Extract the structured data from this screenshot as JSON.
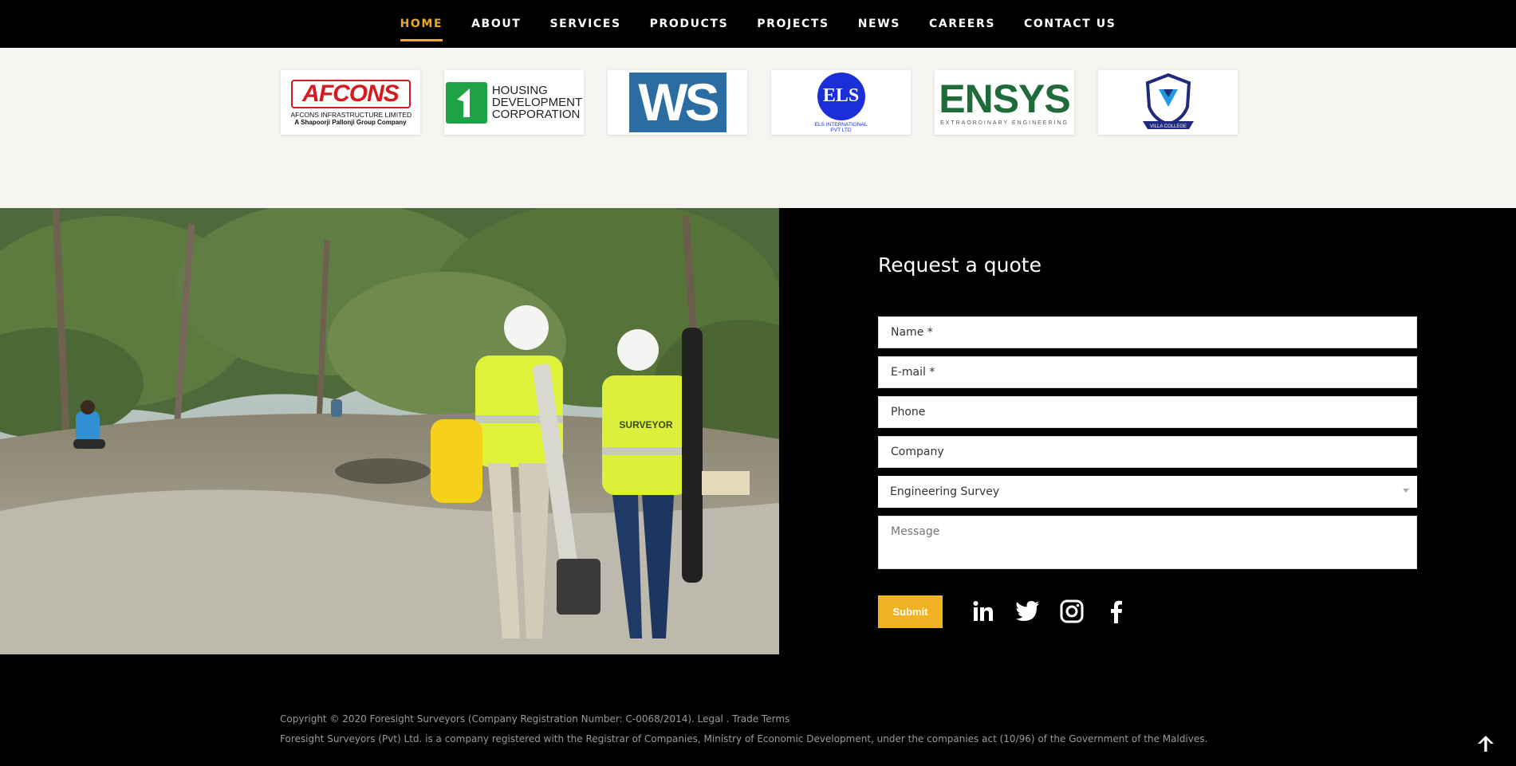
{
  "nav": {
    "items": [
      {
        "label": "HOME",
        "active": true
      },
      {
        "label": "ABOUT"
      },
      {
        "label": "SERVICES"
      },
      {
        "label": "PRODUCTS"
      },
      {
        "label": "PROJECTS"
      },
      {
        "label": "NEWS"
      },
      {
        "label": "CAREERS"
      },
      {
        "label": "CONTACT US"
      }
    ],
    "accent_color": "#e8a92a"
  },
  "clients": {
    "logos": [
      {
        "name": "afcons-logo",
        "title": "AFCONS",
        "line1": "AFCONS INFRASTRUCTURE LIMITED",
        "line2": "A Shapoorji Pallonji Group Company",
        "color": "#d71920"
      },
      {
        "name": "hdc-logo",
        "line1": "HOUSING",
        "line2": "DEVELOPMENT",
        "line3": "CORPORATION",
        "color": "#1da346"
      },
      {
        "name": "ws-logo",
        "title": "WS",
        "color": "#2b6ca3"
      },
      {
        "name": "els-logo",
        "title": "ELS",
        "line1": "ELS INTERNATIONAL",
        "line2": "PVT LTD",
        "color": "#1a2fd8"
      },
      {
        "name": "ensys-logo",
        "title": "ENSYS",
        "line1": "EXTRAORDINARY ENGINEERING",
        "color": "#1f6b3a"
      },
      {
        "name": "villa-college-logo",
        "line1": "VILLA COLLEGE",
        "color": "#1f2a7a"
      }
    ]
  },
  "quote_form": {
    "title": "Request a quote",
    "name_placeholder": "Name *",
    "email_placeholder": "E-mail *",
    "phone_placeholder": "Phone",
    "company_placeholder": "Company",
    "service_selected": "Engineering Survey",
    "message_placeholder": "Message",
    "submit_label": "Submit",
    "submit_color": "#f0b223"
  },
  "social": [
    "linkedin-icon",
    "twitter-icon",
    "instagram-icon",
    "facebook-icon"
  ],
  "footer": {
    "copyright": "Copyright © 2020 Foresight Surveyors (Company Registration Number: C-0068/2014). Legal . Trade Terms",
    "registration": "Foresight Surveyors (Pvt) Ltd. is a company registered with the Registrar of Companies, Ministry of Economic Development, under the companies act (10/96) of the Government of the Maldives."
  },
  "photo": {
    "vest_label": "SURVEYOR"
  }
}
